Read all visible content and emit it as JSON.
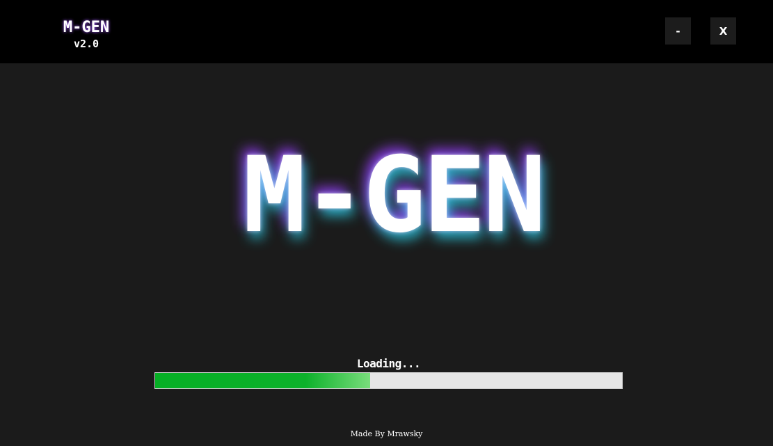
{
  "app": {
    "logo_text": "M-GEN",
    "version": "v2.0"
  },
  "window_controls": {
    "minimize_label": "-",
    "close_label": "X"
  },
  "splash": {
    "logo_text": "M-GEN",
    "glow_colors": [
      "#9b3dff",
      "#2ee6ff"
    ]
  },
  "loading": {
    "label": "Loading...",
    "progress": 0.46,
    "fill_color": "#06b025",
    "track_color": "#e6e6e6"
  },
  "footer": {
    "credit": "Made By Mrawsky"
  }
}
